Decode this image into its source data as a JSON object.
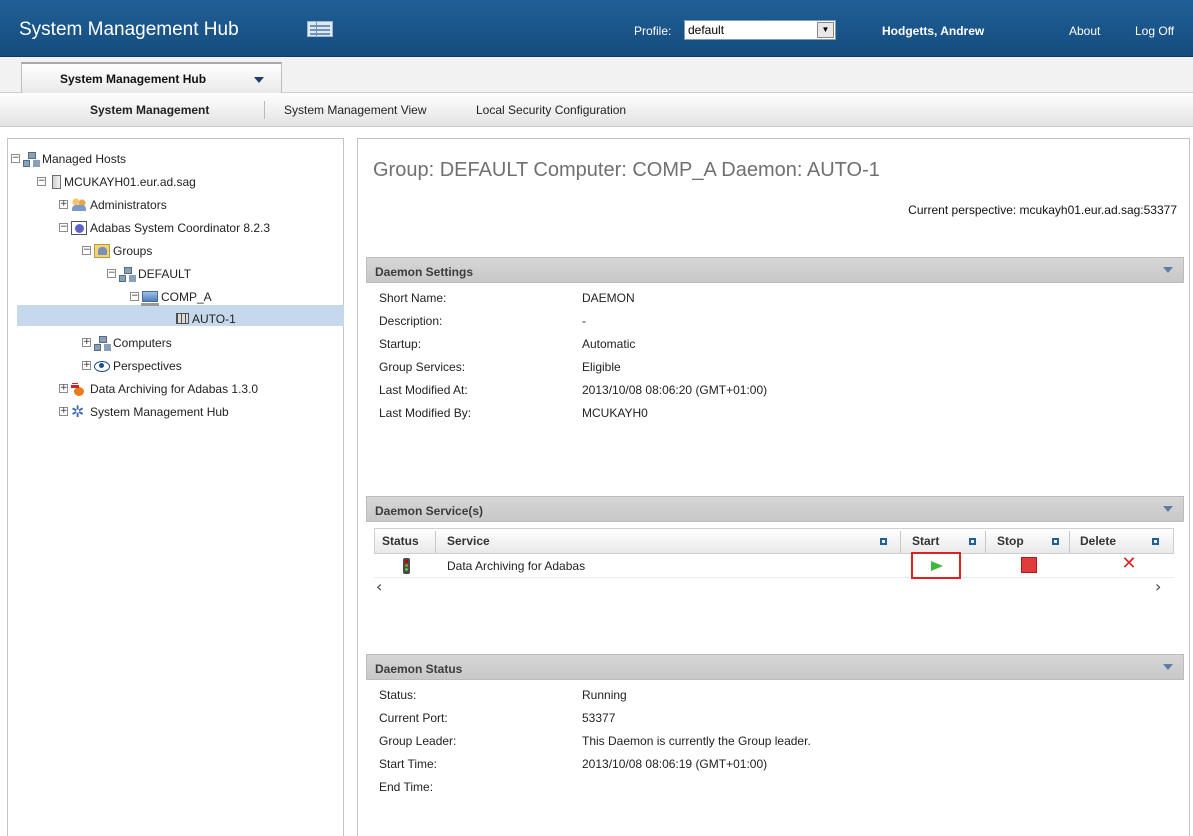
{
  "header": {
    "app_title": "System Management Hub",
    "profile_label": "Profile:",
    "profile_value": "default",
    "user_name": "Hodgetts, Andrew",
    "about": "About",
    "logoff": "Log Off"
  },
  "app_tab": {
    "label": "System Management Hub"
  },
  "subnav": {
    "items": [
      "System Management",
      "System Management View",
      "Local Security Configuration"
    ]
  },
  "tree": {
    "items": [
      {
        "label": "Managed Hosts",
        "expander": "−",
        "icon": "network-icon"
      },
      {
        "label": "MCUKAYH01.eur.ad.sag",
        "expander": "−",
        "icon": "server-icon"
      },
      {
        "label": "Administrators",
        "expander": "+",
        "icon": "administrators-icon"
      },
      {
        "label": "Adabas System Coordinator 8.2.3",
        "expander": "−",
        "icon": "database-icon"
      },
      {
        "label": "Groups",
        "expander": "−",
        "icon": "groups-icon"
      },
      {
        "label": "DEFAULT",
        "expander": "−",
        "icon": "network-icon"
      },
      {
        "label": "COMP_A",
        "expander": "−",
        "icon": "computer-icon"
      },
      {
        "label": "AUTO-1",
        "expander": "",
        "icon": "grid-icon"
      },
      {
        "label": "Computers",
        "expander": "+",
        "icon": "network-icon"
      },
      {
        "label": "Perspectives",
        "expander": "+",
        "icon": "eye-icon"
      },
      {
        "label": "Data Archiving for Adabas 1.3.0",
        "expander": "+",
        "icon": "archiving-icon"
      },
      {
        "label": "System Management Hub",
        "expander": "+",
        "icon": "smh-icon"
      }
    ]
  },
  "main": {
    "title": "Group: DEFAULT Computer: COMP_A Daemon: AUTO-1",
    "perspective": "Current perspective: mcukayh01.eur.ad.sag:53377",
    "daemon_settings": {
      "title": "Daemon Settings",
      "rows": [
        {
          "k": "Short Name:",
          "v": "DAEMON"
        },
        {
          "k": "Description:",
          "v": "-"
        },
        {
          "k": "Startup:",
          "v": "Automatic"
        },
        {
          "k": "Group Services:",
          "v": "Eligible"
        },
        {
          "k": "Last Modified At:",
          "v": "2013/10/08 08:06:20 (GMT+01:00)"
        },
        {
          "k": "Last Modified By:",
          "v": "MCUKAYH0"
        }
      ]
    },
    "daemon_services": {
      "title": "Daemon Service(s)",
      "columns": [
        "Status",
        "Service",
        "Start",
        "Stop",
        "Delete"
      ],
      "rows": [
        {
          "service": "Data Archiving for Adabas"
        }
      ],
      "scroll_left": "‹",
      "scroll_right": "›"
    },
    "daemon_status": {
      "title": "Daemon Status",
      "rows": [
        {
          "k": "Status:",
          "v": "Running"
        },
        {
          "k": "Current Port:",
          "v": "53377"
        },
        {
          "k": "Group Leader:",
          "v": "This Daemon is currently the Group leader."
        },
        {
          "k": "Start Time:",
          "v": "2013/10/08 08:06:19 (GMT+01:00)"
        },
        {
          "k": "End Time:",
          "v": ""
        }
      ]
    }
  },
  "colors": {
    "topbar": "#1b5688",
    "selection": "#c5d8ec",
    "highlight_box": "#e0201f",
    "start_green": "#3fb63f",
    "stop_red": "#e23b3b"
  }
}
